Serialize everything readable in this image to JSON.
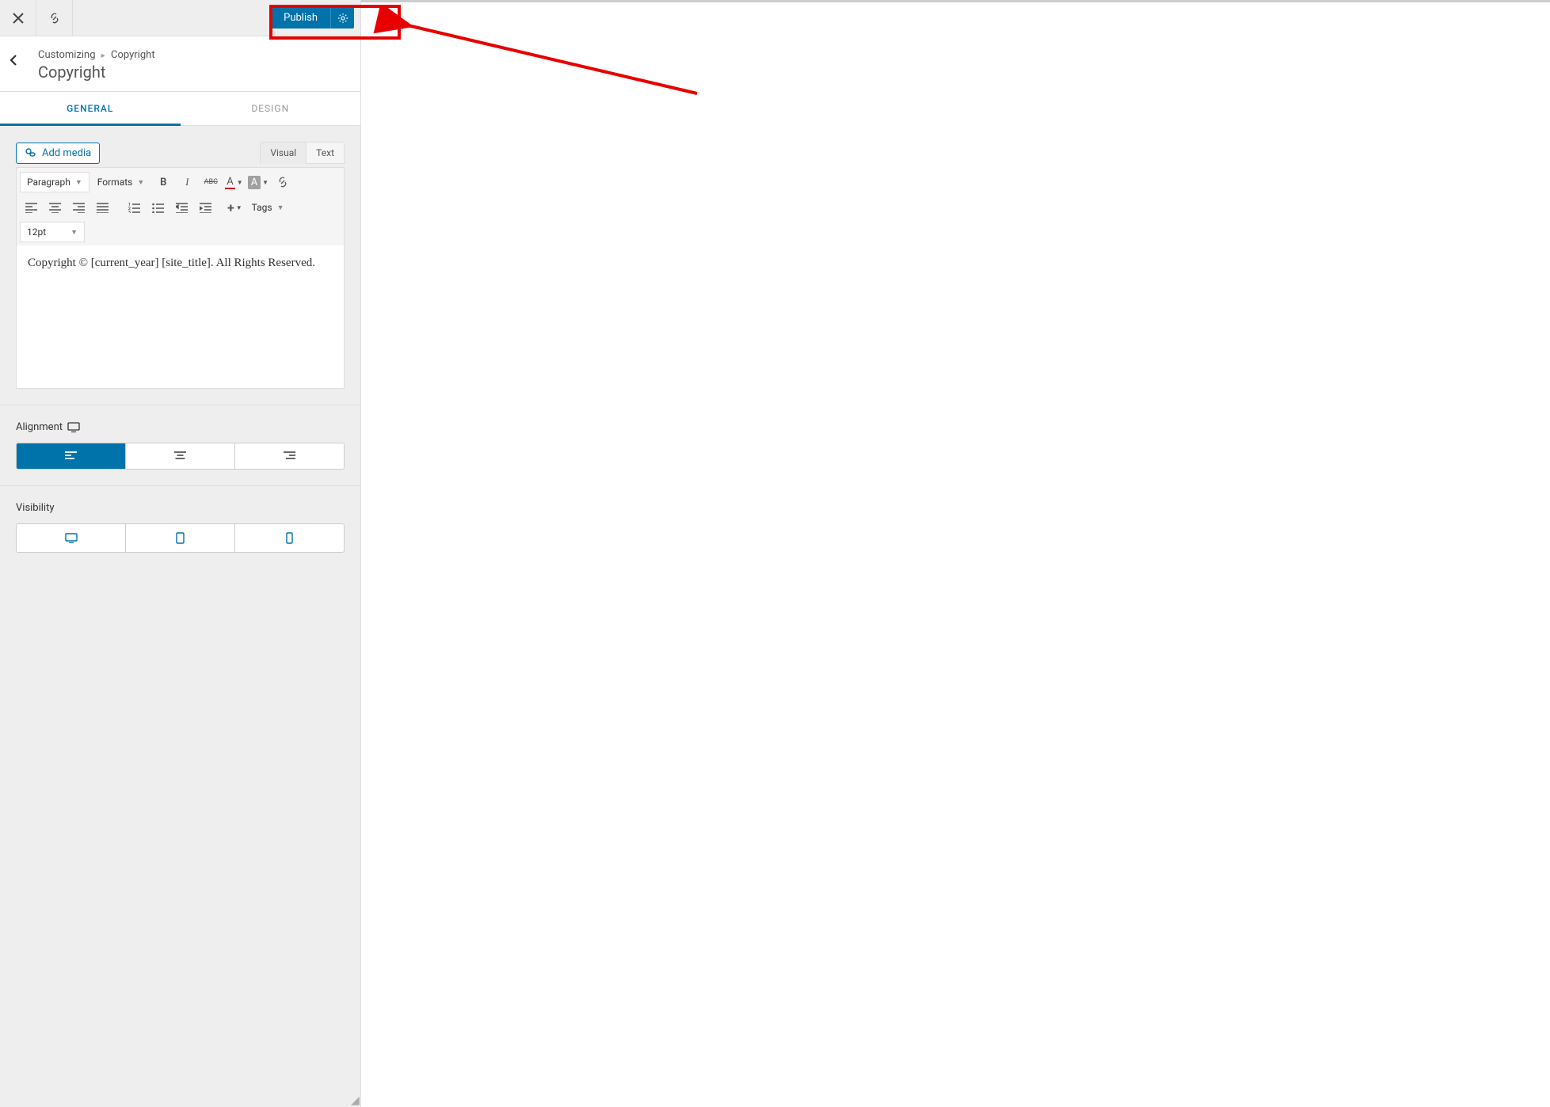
{
  "header": {
    "publish_label": "Publish"
  },
  "breadcrumb": {
    "root": "Customizing",
    "leaf": "Copyright",
    "title": "Copyright"
  },
  "tabs": {
    "general": "GENERAL",
    "design": "DESIGN"
  },
  "editor": {
    "add_media": "Add media",
    "tab_visual": "Visual",
    "tab_text": "Text",
    "paragraph": "Paragraph",
    "formats": "Formats",
    "font_size": "12pt",
    "tags": "Tags",
    "strikethrough_label": "ABC",
    "text_color_label": "A",
    "bg_color_label": "A",
    "content": "Copyright © [current_year] [site_title]. All Rights Reserved."
  },
  "alignment": {
    "label": "Alignment"
  },
  "visibility": {
    "label": "Visibility"
  }
}
